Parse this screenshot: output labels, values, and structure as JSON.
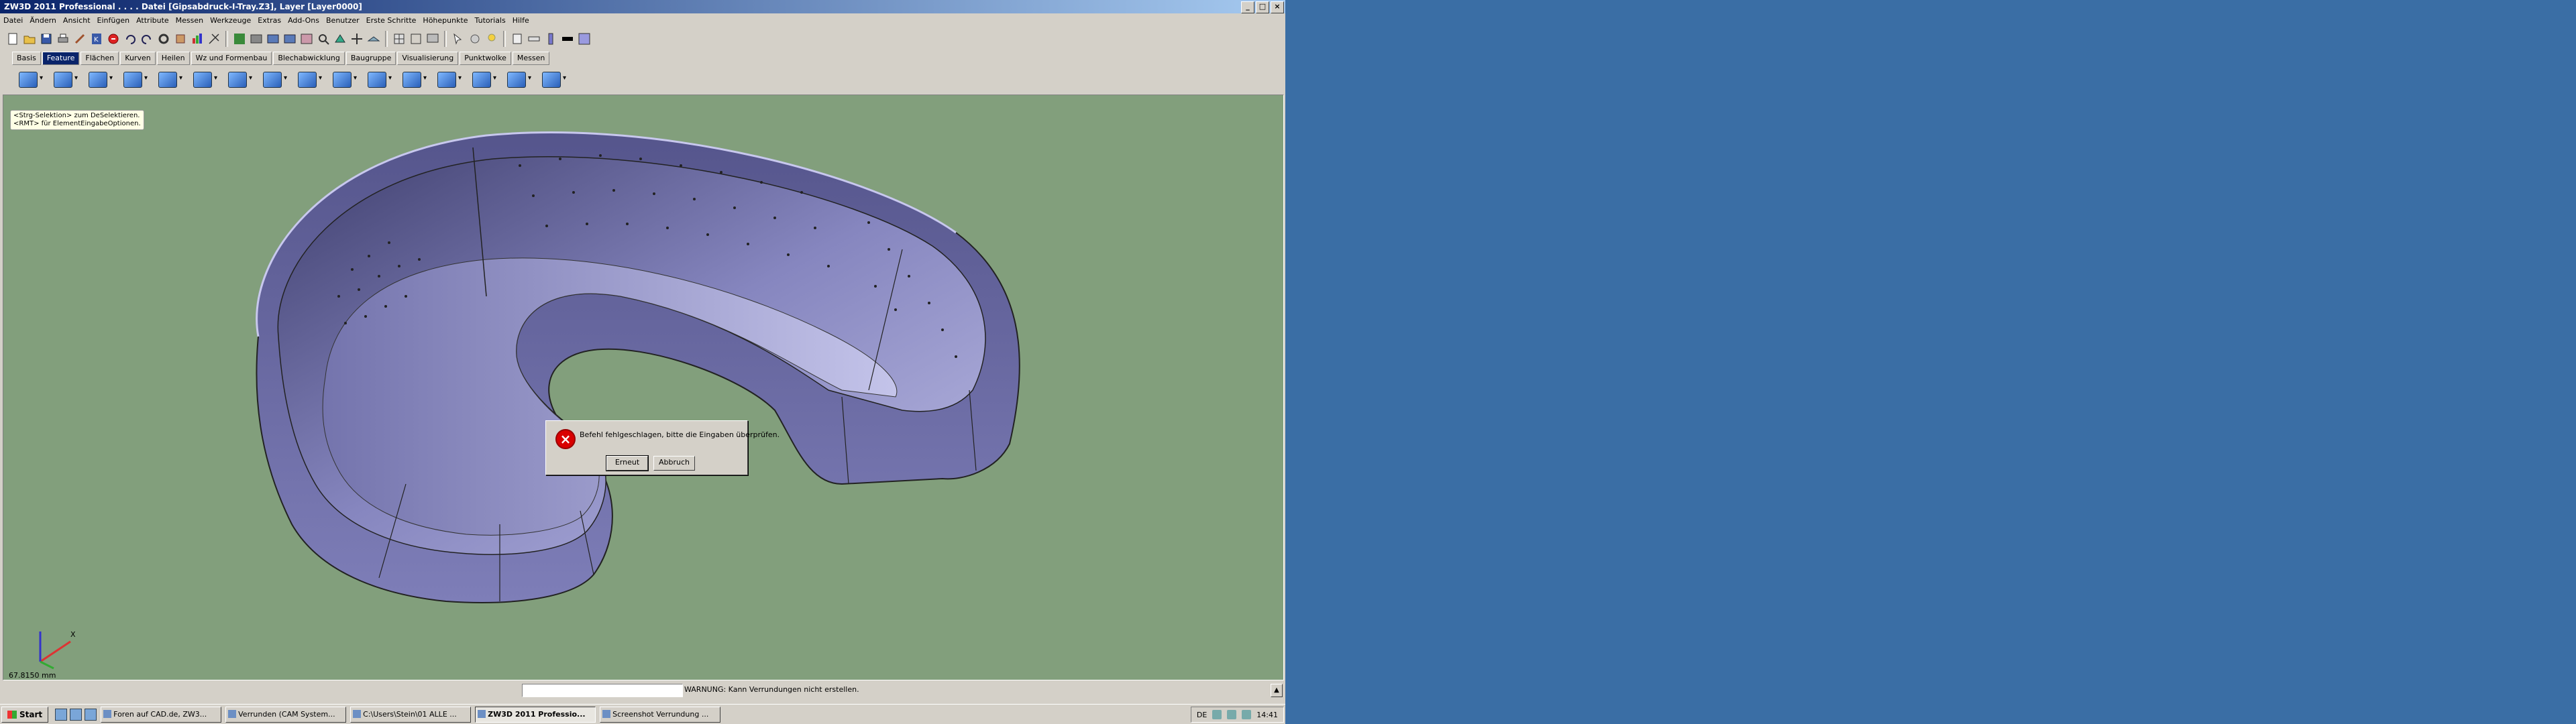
{
  "window": {
    "title": "ZW3D 2011 Professional       . . . . Datei [Gipsabdruck-I-Tray.Z3], Layer [Layer0000]",
    "controls": [
      "_",
      "□",
      "×"
    ]
  },
  "menu": [
    "Datei",
    "Ändern",
    "Ansicht",
    "Einfügen",
    "Attribute",
    "Messen",
    "Werkzeuge",
    "Extras",
    "Add-Ons",
    "Benutzer",
    "Erste Schritte",
    "Höhepunkte",
    "Tutorials",
    "Hilfe"
  ],
  "tabs": [
    "Basis",
    "Feature",
    "Flächen",
    "Kurven",
    "Heilen",
    "Wz und Formenbau",
    "Blechabwicklung",
    "Baugruppe",
    "Visualisierung",
    "Punktwolke",
    "Messen"
  ],
  "active_tab": "Feature",
  "viewport": {
    "hint_line1": "<Strg-Selektion> zum DeSelektieren.",
    "hint_line2": "<RMT> für ElementEingabeOptionen.",
    "coordinate": "67.8150 mm",
    "axis_x": "X"
  },
  "dialog": {
    "message": "Befehl fehlgeschlagen, bitte die Eingaben überprüfen.",
    "retry_label": "Erneut",
    "cancel_label": "Abbruch"
  },
  "status": {
    "message": "WARNUNG: Kann Verrundungen nicht erstellen."
  },
  "taskbar": {
    "start_label": "Start",
    "tasks": [
      {
        "label": "Foren auf CAD.de, ZW3...",
        "active": false
      },
      {
        "label": "Verrunden (CAM System...",
        "active": false
      },
      {
        "label": "C:\\Users\\Stein\\01 ALLE ...",
        "active": false
      },
      {
        "label": "ZW3D 2011 Professio...",
        "active": true
      },
      {
        "label": "Screenshot Verrundung ...",
        "active": false
      }
    ],
    "language": "DE",
    "clock": "14:41"
  },
  "colors": {
    "viewport_bg": "#829f7c",
    "model": "#6e6ea8",
    "desktop": "#3a6ea5"
  }
}
